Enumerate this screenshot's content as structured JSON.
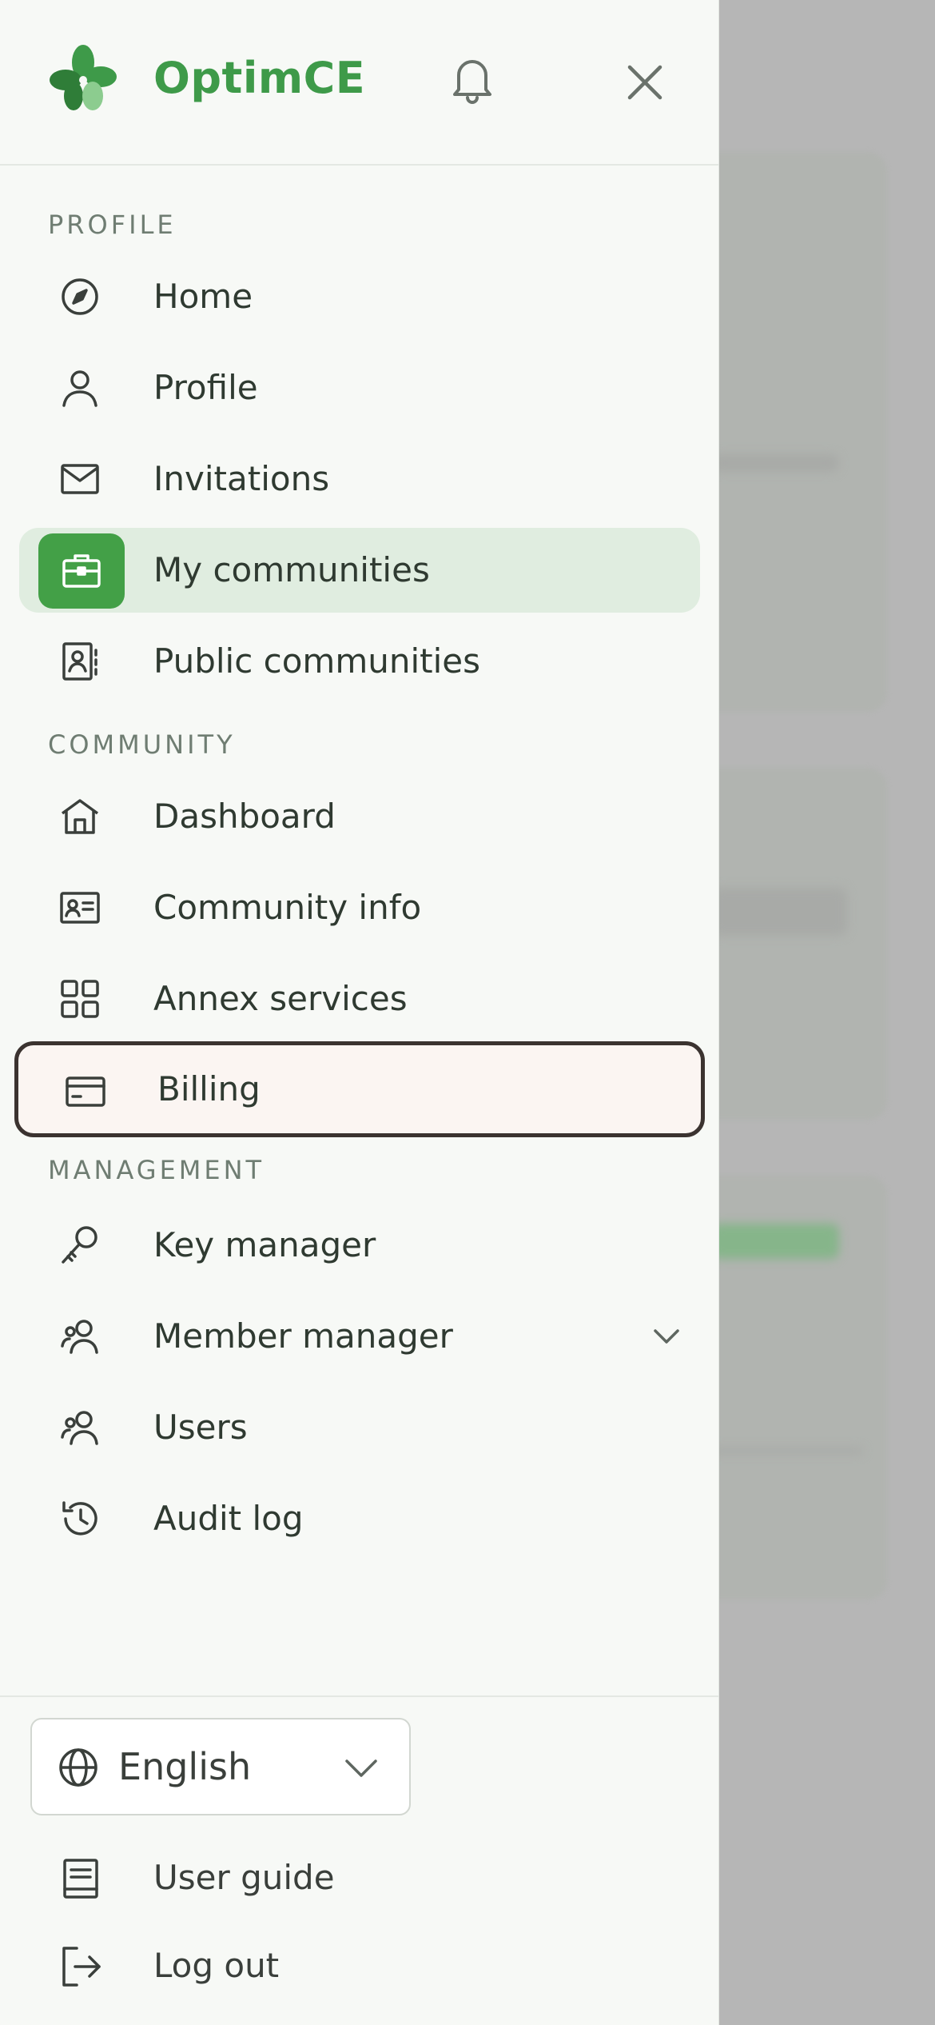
{
  "brand": {
    "name": "OptimCE"
  },
  "sections": {
    "profile": "PROFILE",
    "community": "COMMUNITY",
    "management": "MANAGEMENT"
  },
  "nav": {
    "home": "Home",
    "profile": "Profile",
    "invitations": "Invitations",
    "my_communities": "My communities",
    "public_communities": "Public communities",
    "dashboard": "Dashboard",
    "community_info": "Community info",
    "annex_services": "Annex services",
    "billing": "Billing",
    "key_manager": "Key manager",
    "member_manager": "Member manager",
    "users": "Users",
    "audit_log": "Audit log"
  },
  "footer": {
    "language": "English",
    "user_guide": "User guide",
    "log_out": "Log out"
  },
  "colors": {
    "brand": "#3e9a49",
    "active_bg": "#e0ede0",
    "active_icon_bg": "#43a047",
    "focus_border": "#3b3330"
  }
}
